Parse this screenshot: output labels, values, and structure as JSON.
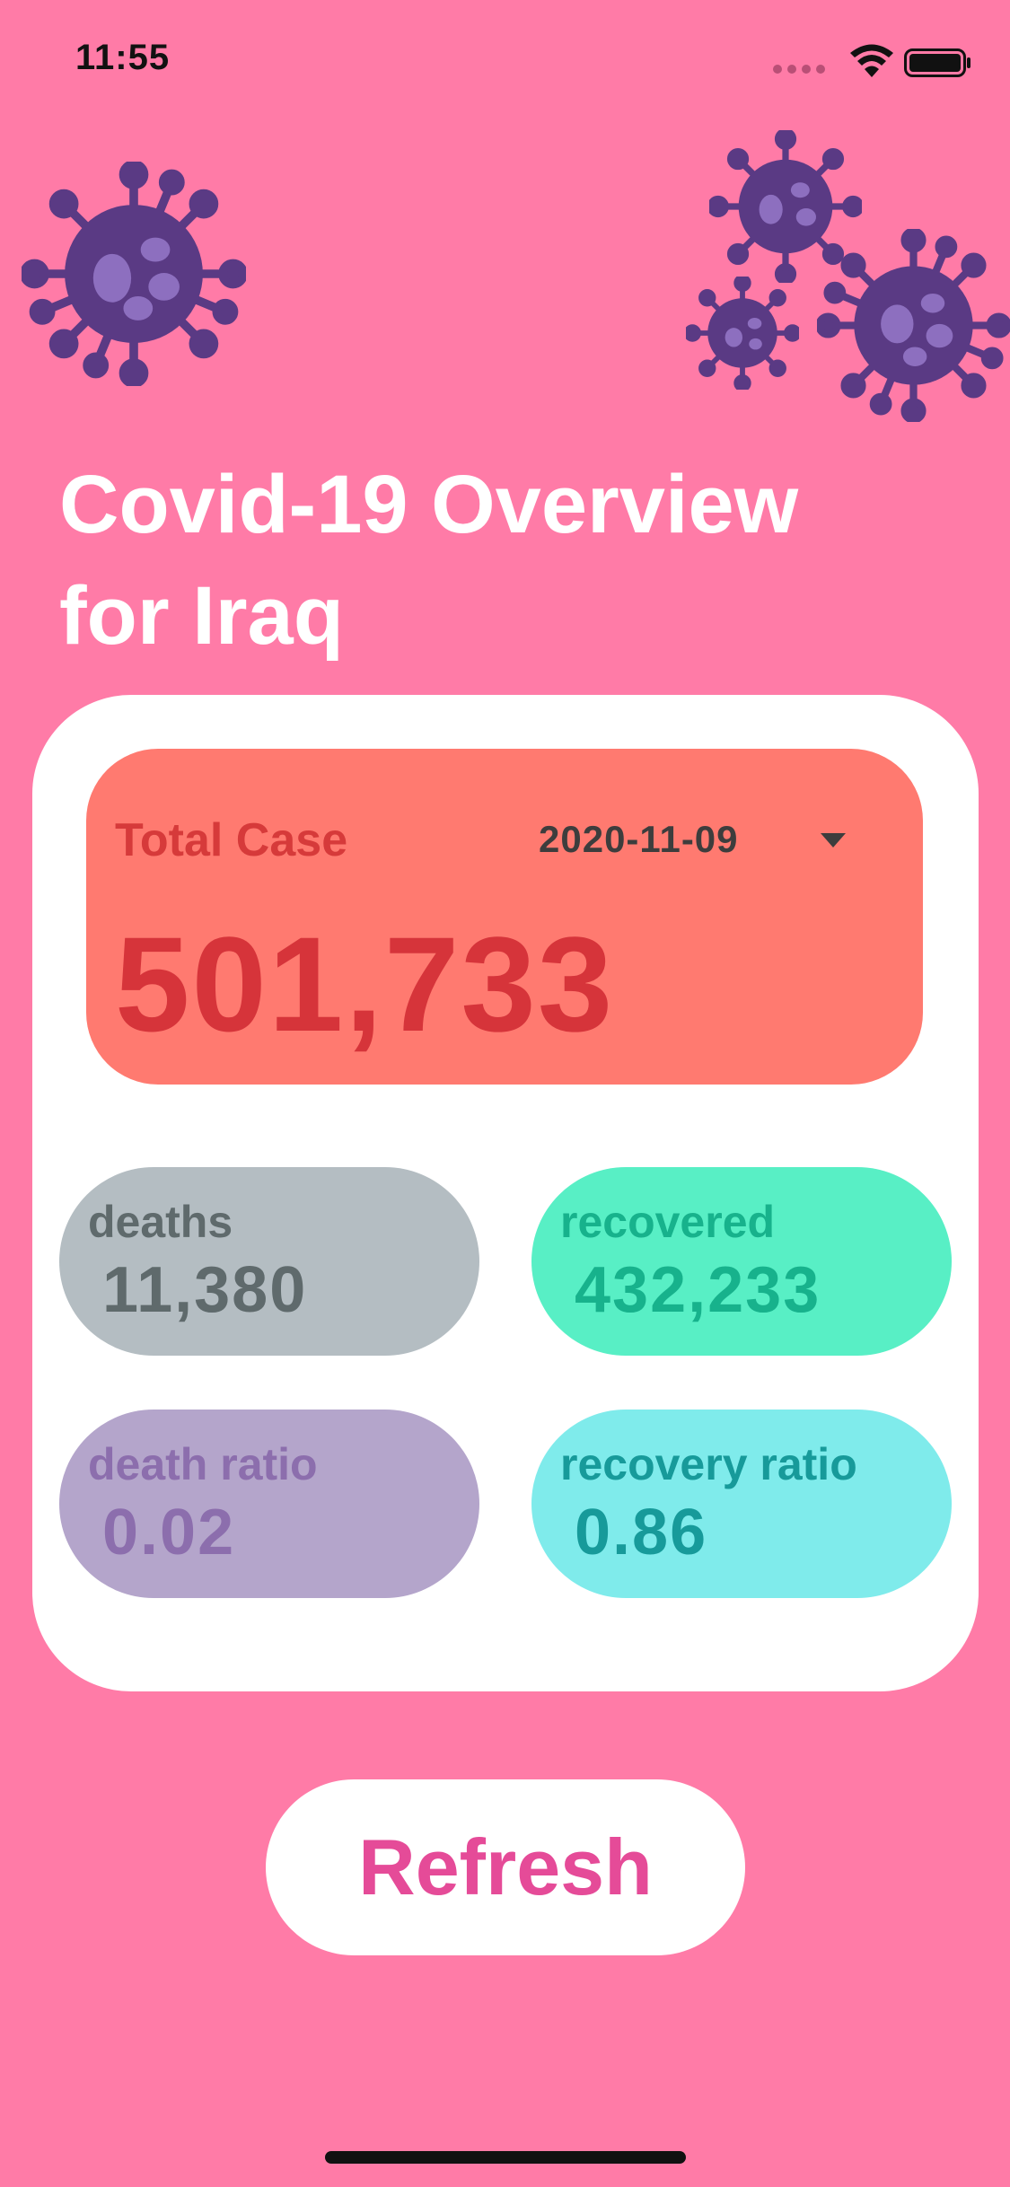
{
  "status_bar": {
    "time": "11:55"
  },
  "header": {
    "title_line1": "Covid-19 Overview",
    "title_line2": "for Iraq"
  },
  "total": {
    "label": "Total Case",
    "date": "2020-11-09",
    "value": "501,733"
  },
  "stats": {
    "deaths": {
      "label": "deaths",
      "value": "11,380"
    },
    "recovered": {
      "label": "recovered",
      "value": "432,233"
    },
    "death_ratio": {
      "label": "death ratio",
      "value": "0.02"
    },
    "recovery_ratio": {
      "label": "recovery ratio",
      "value": "0.86"
    }
  },
  "actions": {
    "refresh_label": "Refresh"
  },
  "colors": {
    "background": "#FF7BA7",
    "total_box": "#FF7A70",
    "deaths": "#B4BDC2",
    "recovered": "#58EFC5",
    "death_ratio": "#B4A5CB",
    "recovery_ratio": "#7FEBEB",
    "refresh_text": "#E54B98",
    "virus": "#5A3A84"
  },
  "icons": [
    "signal-icon",
    "wifi-icon",
    "battery-icon",
    "virus-icon",
    "dropdown-arrow-icon"
  ]
}
